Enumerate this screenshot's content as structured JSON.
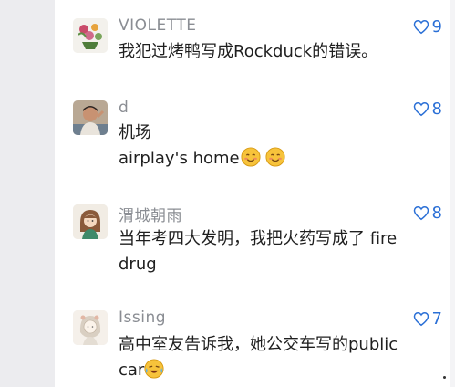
{
  "comments": [
    {
      "avatar": "flower-bouquet-avatar",
      "username": "VIOLETTE",
      "likes": "9",
      "lines": [
        "我犯过烤鸭写成Rockduck的错误。"
      ]
    },
    {
      "avatar": "person-photo-avatar",
      "username": "d",
      "likes": "8",
      "lines": [
        "机场",
        "airplay's  home"
      ],
      "emoji": "smiling-face-emoji"
    },
    {
      "avatar": "cartoon-girl-avatar",
      "username": "渭城朝雨",
      "likes": "8",
      "lines": [
        "当年考四大发明，我把火药写成了 fire",
        "drug"
      ]
    },
    {
      "avatar": "sketch-girl-avatar",
      "username": "Issing",
      "likes": "7",
      "lines": [
        "高中室友告诉我，她公交车写的public",
        "car"
      ],
      "emoji": "crying-laughing-emoji"
    }
  ],
  "colors": {
    "username": "#8a8d93",
    "like": "#2a6fd6",
    "text": "#1f1f1f"
  }
}
